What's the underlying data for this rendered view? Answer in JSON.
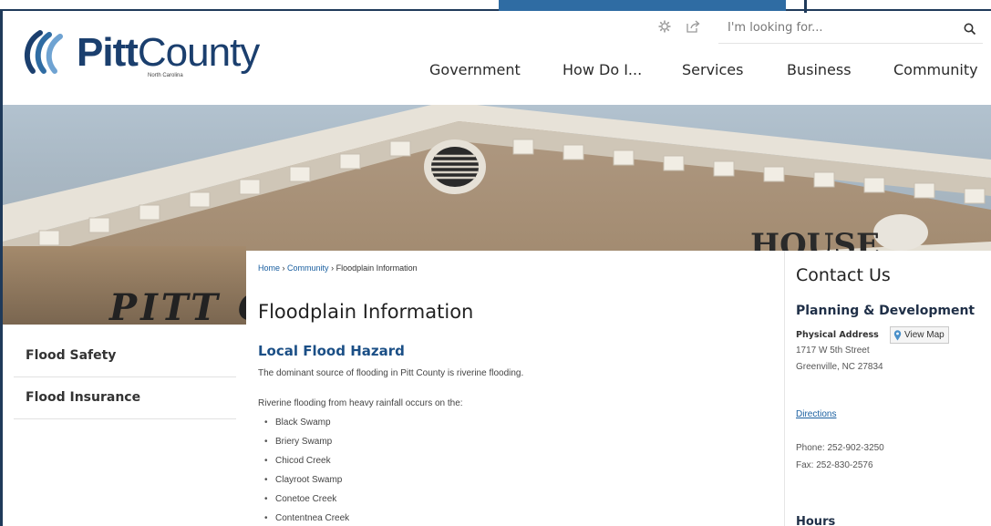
{
  "header": {
    "logo_main": "Pitt",
    "logo_second": "County",
    "logo_sub": "North Carolina",
    "search": {
      "placeholder": "I'm looking for..."
    },
    "icons": [
      "gear-icon",
      "share-icon",
      "search-icon"
    ],
    "nav": [
      "Government",
      "How Do I...",
      "Services",
      "Business",
      "Community"
    ]
  },
  "hero": {
    "sign_text": "PITT C"
  },
  "breadcrumb": {
    "items": [
      "Home",
      "Community",
      "Floodplain Information"
    ],
    "separator": "›"
  },
  "main": {
    "title": "Floodplain Information",
    "section_heading": "Local Flood Hazard",
    "intro": "The dominant source of flooding in Pitt County is riverine flooding.",
    "list_intro": "Riverine flooding from heavy rainfall occurs on the:",
    "waterways": [
      "Black Swamp",
      "Briery Swamp",
      "Chicod Creek",
      "Clayroot Swamp",
      "Conetoe Creek",
      "Contentnea Creek"
    ]
  },
  "sidebar": {
    "items": [
      {
        "label": "Flood Safety"
      },
      {
        "label": "Flood Insurance"
      }
    ]
  },
  "contact": {
    "title": "Contact Us",
    "department": "Planning & Development",
    "address_label": "Physical Address",
    "view_map": "View Map",
    "address_line1": "1717 W 5th Street",
    "address_line2": "Greenville, NC 27834",
    "directions": "Directions",
    "phone": "Phone: 252-902-3250",
    "fax": "Fax: 252-830-2576",
    "hours_title": "Hours"
  },
  "colors": {
    "brand": "#1b3f6e",
    "link": "#1a5fa0",
    "accent_tab": "#2f6ca3"
  }
}
